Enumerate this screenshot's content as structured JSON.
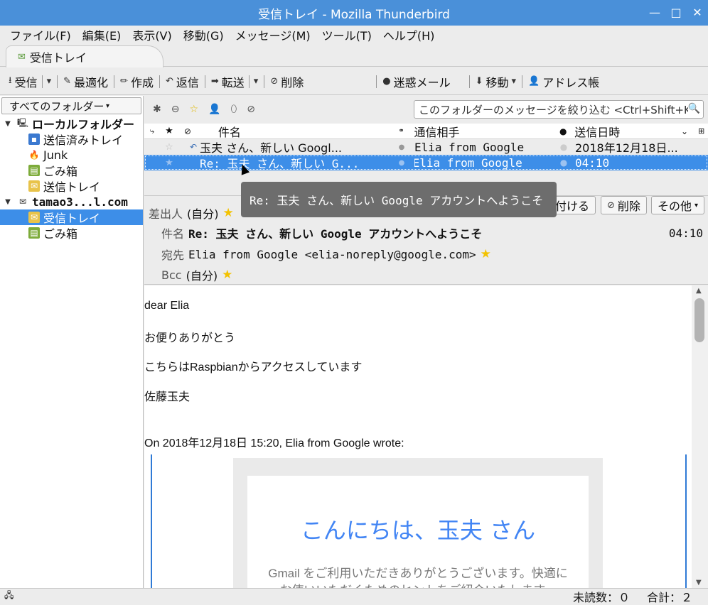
{
  "window": {
    "title": "受信トレイ - Mozilla Thunderbird",
    "controls": [
      "—",
      "□",
      "✕"
    ]
  },
  "menu": [
    "ファイル(F)",
    "編集(E)",
    "表示(V)",
    "移動(G)",
    "メッセージ(M)",
    "ツール(T)",
    "ヘルプ(H)"
  ],
  "tab": {
    "label": "受信トレイ"
  },
  "toolbar": {
    "get": "受信",
    "optimize": "最適化",
    "write": "作成",
    "reply": "返信",
    "forward": "転送",
    "delete": "削除",
    "junk": "迷惑メール",
    "move": "移動",
    "addressbook": "アドレス帳"
  },
  "folders": {
    "selector": "すべてのフォルダー",
    "local": {
      "name": "ローカルフォルダー",
      "items": [
        "送信済みトレイ",
        "Junk",
        "ごみ箱",
        "送信トレイ"
      ]
    },
    "account": {
      "name": "tamao3...l.com",
      "items": [
        "受信トレイ",
        "ごみ箱"
      ]
    }
  },
  "filter": {
    "placeholder": "このフォルダーのメッセージを絞り込む <Ctrl+Shift+K>"
  },
  "columns": {
    "subject": "件名",
    "correspondent": "通信相手",
    "date": "送信日時"
  },
  "messages": [
    {
      "subject": "玉夫 さん、新しい Googl...",
      "from": "Elia from Google",
      "date": "2018年12月18日..."
    },
    {
      "subject": "Re: 玉夫 さん、新しい G...",
      "from": "Elia from Google",
      "date": "04:10"
    }
  ],
  "tooltip": "Re: 玉夫 さん、新しい Google アカウントへようこそ",
  "header": {
    "from_label": "差出人",
    "from_value": "(自分)",
    "subject_label": "件名",
    "subject_value": "Re: 玉夫 さん、新しい Google アカウントへようこそ",
    "time": "04:10",
    "to_label": "宛先",
    "to_value": "Elia from Google <elia-noreply@google.com>",
    "bcc_label": "Bcc",
    "bcc_value": "(自分)",
    "btn_tag": "付ける",
    "btn_delete": "削除",
    "btn_other": "その他"
  },
  "body": {
    "line1": "dear Elia",
    "line2": "お便りありがとう",
    "line3": "こちらはRaspbianからアクセスしています",
    "line4": "佐藤玉夫",
    "quote_intro": "On 2018年12月18日 15:20, Elia from Google wrote:",
    "card_title": "こんにちは、玉夫 さん",
    "card_text1": "Gmail をご利用いただきありがとうございます。快適に",
    "card_text2": "お使いいただくためのヒントをご紹介いたします。"
  },
  "status": {
    "unread": "未読数：０",
    "total": "合計：２"
  },
  "colors": {
    "accent": "#3d8ee8",
    "titlebar": "#4a90d9",
    "star": "#f3c200",
    "google_blue": "#4285f4"
  }
}
